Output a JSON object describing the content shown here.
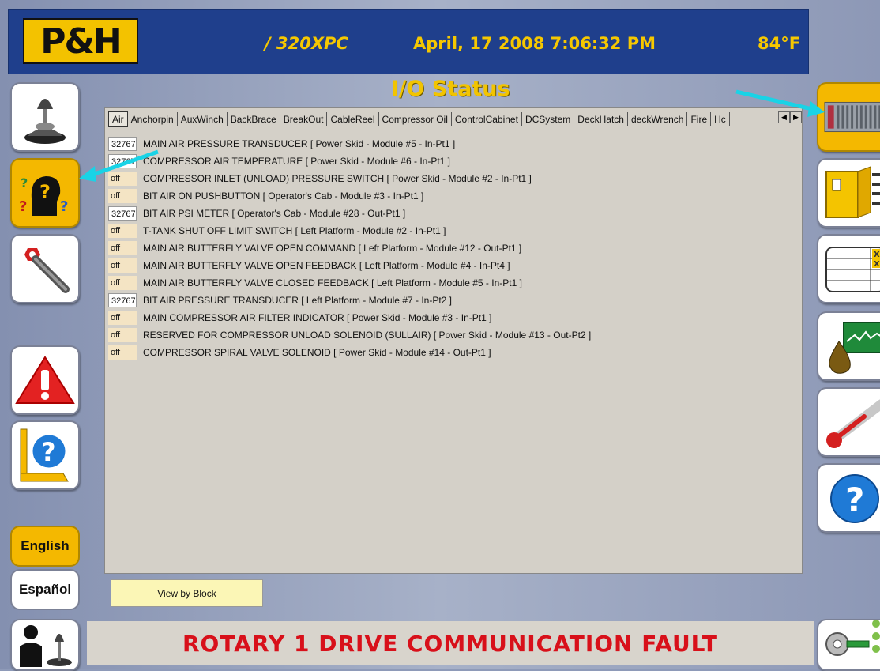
{
  "header": {
    "logo": "P&H",
    "model": "/ 320XPC",
    "datetime": "April, 17 2008 7:06:32 PM",
    "temperature": "84°F"
  },
  "page_title": "I/O Status",
  "tabs": [
    "Air",
    "Anchorpin",
    "AuxWinch",
    "BackBrace",
    "BreakOut",
    "CableReel",
    "Compressor Oil",
    "ControlCabinet",
    "DCSystem",
    "DeckHatch",
    "deckWrench",
    "Fire",
    "Hc"
  ],
  "active_tab": "Air",
  "io_rows": [
    {
      "value": "32767",
      "label": "MAIN AIR PRESSURE TRANSDUCER [ Power Skid - Module #5 - In-Pt1 ]"
    },
    {
      "value": "32767",
      "label": "COMPRESSOR AIR TEMPERATURE [ Power Skid - Module #6 - In-Pt1 ]"
    },
    {
      "value": "off",
      "label": "COMPRESSOR INLET (UNLOAD) PRESSURE SWITCH [ Power Skid - Module #2 - In-Pt1 ]"
    },
    {
      "value": "off",
      "label": "BIT AIR ON PUSHBUTTON [ Operator's Cab - Module #3 - In-Pt1 ]"
    },
    {
      "value": "32767",
      "label": "BIT AIR PSI METER [ Operator's Cab - Module #28 - Out-Pt1 ]"
    },
    {
      "value": "off",
      "label": "T-TANK SHUT OFF LIMIT SWITCH [ Left Platform - Module #2 - In-Pt1 ]"
    },
    {
      "value": "off",
      "label": "MAIN AIR BUTTERFLY VALVE  OPEN COMMAND [ Left Platform - Module #12 - Out-Pt1 ]"
    },
    {
      "value": "off",
      "label": "MAIN AIR BUTTERFLY VALVE OPEN FEEDBACK [ Left Platform - Module #4 - In-Pt4 ]"
    },
    {
      "value": "off",
      "label": "MAIN AIR BUTTERFLY VALVE CLOSED FEEDBACK [ Left Platform - Module #5 - In-Pt1 ]"
    },
    {
      "value": "32767",
      "label": "BIT AIR PRESSURE TRANSDUCER [ Left Platform - Module #7 - In-Pt2 ]"
    },
    {
      "value": "off",
      "label": "MAIN COMPRESSOR AIR FILTER INDICATOR [ Power Skid - Module #3 - In-Pt1 ]"
    },
    {
      "value": "off",
      "label": "RESERVED FOR COMPRESSOR UNLOAD SOLENOID (SULLAIR) [ Power Skid - Module #13 - Out-Pt2 ]"
    },
    {
      "value": "off",
      "label": "COMPRESSOR SPIRAL VALVE SOLENOID  [ Power Skid - Module #14 - Out-Pt1 ]"
    }
  ],
  "view_by_block_label": "View by Block",
  "language": {
    "english": "English",
    "spanish": "Español"
  },
  "alarm_message": "ROTARY 1 DRIVE COMMUNICATION FAULT",
  "colors": {
    "header_bg": "#1f3f8c",
    "header_text": "#f6c800",
    "accent_yellow": "#f4b800",
    "alarm_red": "#d8101a",
    "annotation_arrow": "#19d3e6"
  },
  "icons": {
    "left": [
      "joystick-icon",
      "operator-help-icon",
      "wrench-icon",
      "alarm-warning-icon",
      "mast-help-icon",
      "operator-joystick-icon"
    ],
    "right": [
      "io-rack-icon",
      "cabinet-icon",
      "table-grid-icon",
      "oil-trend-icon",
      "thermometer-icon",
      "help-icon",
      "key-icon"
    ]
  }
}
